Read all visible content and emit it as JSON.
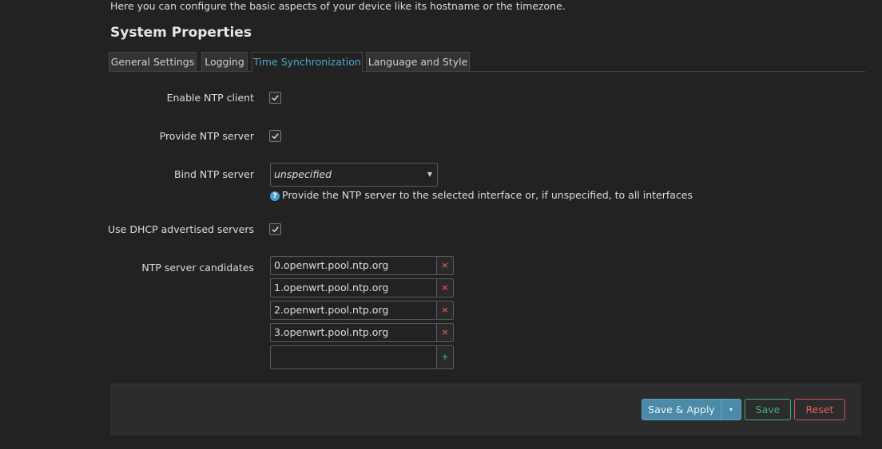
{
  "intro_text": "Here you can configure the basic aspects of your device like its hostname or the timezone.",
  "section_title": "System Properties",
  "tabs": [
    {
      "label": "General Settings",
      "active": false
    },
    {
      "label": "Logging",
      "active": false
    },
    {
      "label": "Time Synchronization",
      "active": true
    },
    {
      "label": "Language and Style",
      "active": false
    }
  ],
  "form": {
    "enable_ntp_client": {
      "label": "Enable NTP client",
      "checked": true
    },
    "provide_ntp_server": {
      "label": "Provide NTP server",
      "checked": true
    },
    "bind_ntp_server": {
      "label": "Bind NTP server",
      "selected": "unspecified",
      "help": "Provide the NTP server to the selected interface or, if unspecified, to all interfaces"
    },
    "use_dhcp_servers": {
      "label": "Use DHCP advertised servers",
      "checked": true
    },
    "ntp_candidates": {
      "label": "NTP server candidates",
      "servers": [
        "0.openwrt.pool.ntp.org",
        "1.openwrt.pool.ntp.org",
        "2.openwrt.pool.ntp.org",
        "3.openwrt.pool.ntp.org"
      ],
      "new_value": "",
      "remove_symbol": "×",
      "add_symbol": "+"
    }
  },
  "actions": {
    "save_apply": "Save & Apply",
    "dropdown_symbol": "▾",
    "save": "Save",
    "reset": "Reset"
  },
  "icons": {
    "help": "help-circle-icon",
    "check": "check-icon",
    "select_arrow": "chevron-down-icon"
  },
  "colors": {
    "accent": "#4fa6c9",
    "save_green": "#3fae74",
    "reset_red": "#d05050",
    "remove_red": "#d9534f"
  }
}
